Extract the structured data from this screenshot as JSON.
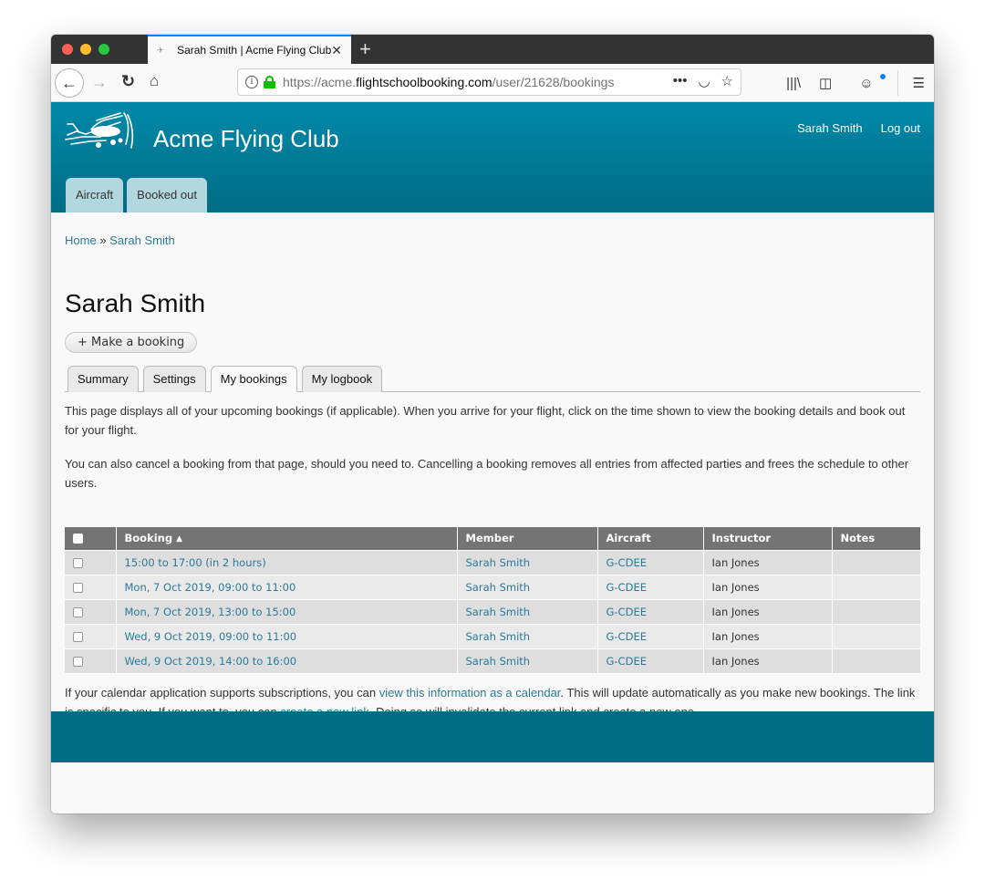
{
  "browser": {
    "tab_title": "Sarah Smith | Acme Flying Club",
    "url_prefix": "https://acme.",
    "url_domain": "flightschoolbooking.com",
    "url_path": "/user/21628/bookings",
    "icons": {
      "back": "←",
      "forward": "→",
      "reload": "↻",
      "home": "⌂",
      "page_actions": "•••",
      "pocket": "◡",
      "bookmark": "☆",
      "library": "|||\\",
      "sidebar": "◫",
      "account": "☺",
      "menu": "☰",
      "close_tab": "✕",
      "new_tab": "+"
    }
  },
  "site": {
    "name": "Acme Flying Club",
    "user_links": [
      {
        "label": "Sarah Smith"
      },
      {
        "label": "Log out"
      }
    ],
    "primary_tabs": [
      {
        "label": "Aircraft"
      },
      {
        "label": "Booked out"
      }
    ]
  },
  "breadcrumb": {
    "home": "Home",
    "separator": "»",
    "current": "Sarah Smith"
  },
  "page": {
    "title": "Sarah Smith",
    "action_button": "+ Make a booking",
    "tabs": [
      {
        "label": "Summary",
        "active": false
      },
      {
        "label": "Settings",
        "active": false
      },
      {
        "label": "My bookings",
        "active": true
      },
      {
        "label": "My logbook",
        "active": false
      }
    ],
    "intro": [
      "This page displays all of your upcoming bookings (if applicable). When you arrive for your flight, click on the time shown to view the booking details and book out for your flight.",
      "You can also cancel a booking from that page, should you need to. Cancelling a booking removes all entries from affected parties and frees the schedule to other users."
    ]
  },
  "table": {
    "columns": [
      "Booking",
      "Member",
      "Aircraft",
      "Instructor",
      "Notes"
    ],
    "sort_indicator": "▲",
    "rows": [
      {
        "booking": "15:00 to 17:00 (in 2 hours)",
        "member": "Sarah Smith",
        "aircraft": "G-CDEE",
        "instructor": "Ian Jones",
        "notes": ""
      },
      {
        "booking": "Mon, 7 Oct 2019, 09:00 to 11:00",
        "member": "Sarah Smith",
        "aircraft": "G-CDEE",
        "instructor": "Ian Jones",
        "notes": ""
      },
      {
        "booking": "Mon, 7 Oct 2019, 13:00 to 15:00",
        "member": "Sarah Smith",
        "aircraft": "G-CDEE",
        "instructor": "Ian Jones",
        "notes": ""
      },
      {
        "booking": "Wed, 9 Oct 2019, 09:00 to 11:00",
        "member": "Sarah Smith",
        "aircraft": "G-CDEE",
        "instructor": "Ian Jones",
        "notes": ""
      },
      {
        "booking": "Wed, 9 Oct 2019, 14:00 to 16:00",
        "member": "Sarah Smith",
        "aircraft": "G-CDEE",
        "instructor": "Ian Jones",
        "notes": ""
      }
    ]
  },
  "calendar_note": {
    "text1": "If your calendar application supports subscriptions, you can ",
    "link1": "view this information as a calendar",
    "text2": ". This will update automatically as you make new bookings. The link is specific to you. If you want to, you can ",
    "link2": "create a new link",
    "text3": ". Doing so will invalidate the current link and create a new one."
  },
  "colors": {
    "header_top": "#0089a9",
    "header_bottom": "#006d86",
    "footer": "#006c84",
    "link": "#2a7a9a",
    "table_header": "#747474"
  }
}
